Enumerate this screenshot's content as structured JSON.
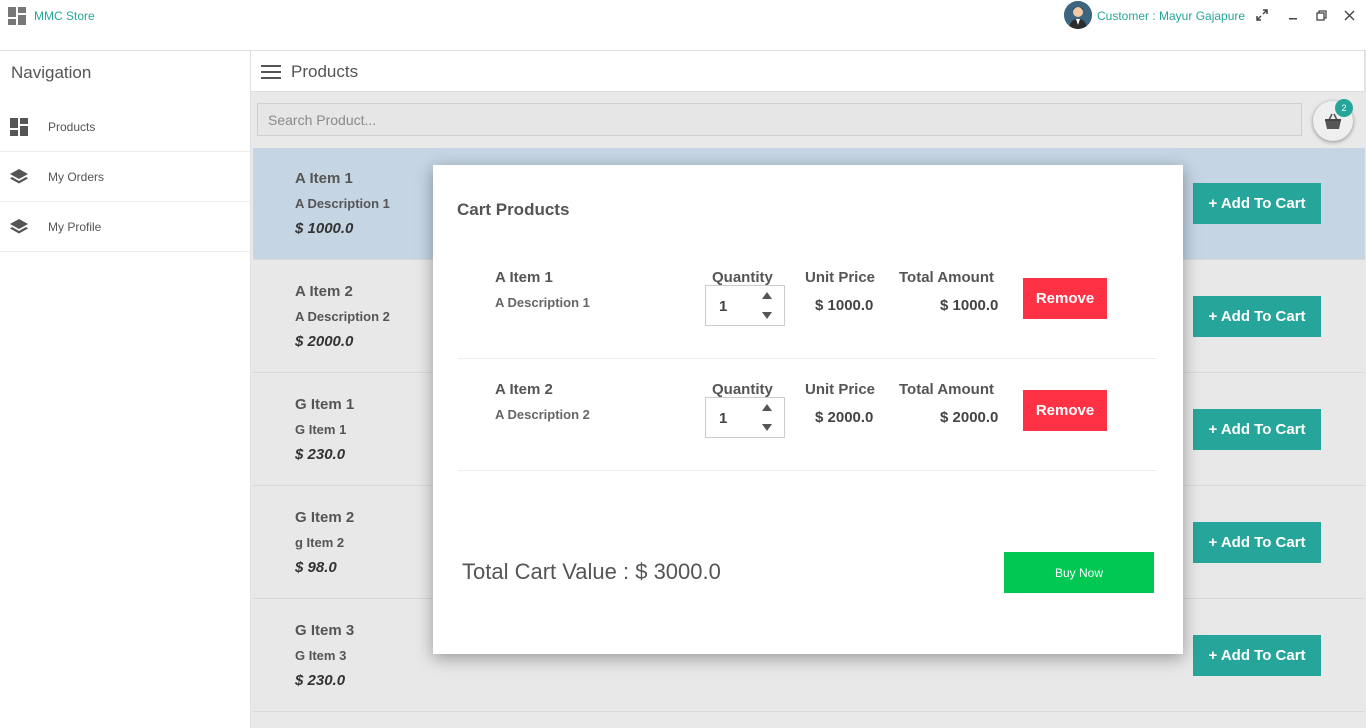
{
  "app": {
    "title": "MMC Store",
    "customer": "Customer : Mayur Gajapure"
  },
  "navigation": {
    "title": "Navigation",
    "items": [
      {
        "label": "Products",
        "icon": "dashboard-icon"
      },
      {
        "label": "My Orders",
        "icon": "layers-icon"
      },
      {
        "label": "My Profile",
        "icon": "layers-icon"
      }
    ]
  },
  "header": {
    "title": "Products"
  },
  "search": {
    "placeholder": "Search Product..."
  },
  "cart": {
    "badge": "2"
  },
  "products": [
    {
      "name": "A Item 1",
      "description": "A Description 1",
      "price": "$ 1000.0",
      "button": "+ Add To Cart"
    },
    {
      "name": "A Item 2",
      "description": "A Description 2",
      "price": "$ 2000.0",
      "button": "+ Add To Cart"
    },
    {
      "name": "G Item 1",
      "description": "G Item 1",
      "price": "$ 230.0",
      "button": "+ Add To Cart"
    },
    {
      "name": "G Item 2",
      "description": "g Item 2",
      "price": "$ 98.0",
      "button": "+ Add To Cart"
    },
    {
      "name": "G Item 3",
      "description": "G Item 3",
      "price": "$ 230.0",
      "button": "+ Add To Cart"
    }
  ],
  "dialog": {
    "title": "Cart Products",
    "quantity_label": "Quantity",
    "unit_price_label": "Unit Price",
    "total_amount_label": "Total Amount",
    "remove_label": "Remove",
    "items": [
      {
        "name": "A Item 1",
        "description": "A Description 1",
        "quantity": "1",
        "unit_price": "$ 1000.0",
        "total": "$ 1000.0"
      },
      {
        "name": "A Item 2",
        "description": "A Description 2",
        "quantity": "1",
        "unit_price": "$ 2000.0",
        "total": "$ 2000.0"
      }
    ],
    "total_cart_value": "Total Cart Value : $ 3000.0",
    "buy_label": "Buy Now"
  },
  "colors": {
    "accent": "#26a69a",
    "remove": "#ff3145",
    "buy": "#00c853",
    "selected_row": "#c5d5e4"
  }
}
